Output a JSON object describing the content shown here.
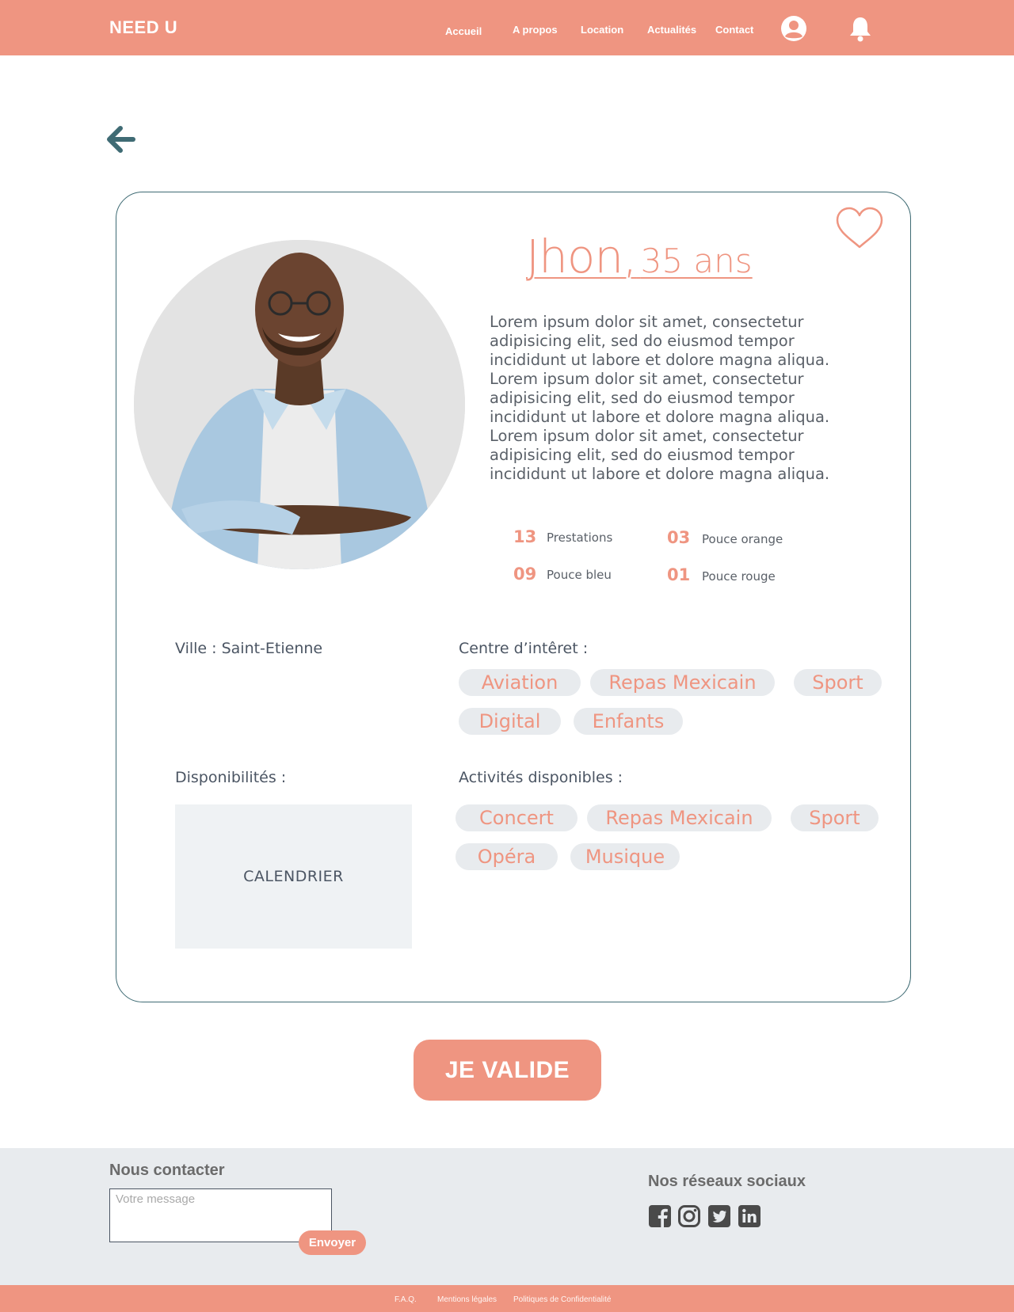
{
  "header": {
    "brand": "NEED U",
    "nav": [
      {
        "label": "Accueil"
      },
      {
        "label": "A propos"
      },
      {
        "label": "Location"
      },
      {
        "label": "Actualités"
      },
      {
        "label": "Contact"
      }
    ],
    "icons": [
      "user-avatar-icon",
      "bell-icon"
    ]
  },
  "profile": {
    "name": "Jhon,",
    "age": "35 ans",
    "bio": "Lorem ipsum dolor sit amet, consectetur adipisicing elit, sed do eiusmod tempor incididunt ut labore et dolore magna aliqua. Lorem ipsum dolor sit amet, consectetur adipisicing elit, sed do eiusmod tempor incididunt ut labore et dolore magna aliqua. Lorem ipsum dolor sit amet, consectetur adipisicing elit, sed do eiusmod tempor incididunt ut labore et dolore magna aliqua.",
    "stats": [
      {
        "value": "13",
        "label": "Prestations"
      },
      {
        "value": "03",
        "label": "Pouce orange"
      },
      {
        "value": "09",
        "label": "Pouce bleu"
      },
      {
        "value": "01",
        "label": "Pouce rouge"
      }
    ],
    "city_label": "Ville : Saint-Etienne",
    "interests_label": "Centre d’intêret :",
    "interests": [
      "Aviation",
      "Repas Mexicain",
      "Sport",
      "Digital",
      "Enfants"
    ],
    "availability_label": "Disponibilités :",
    "calendar_label": "CALENDRIER",
    "activities_label": "Activités disponibles :",
    "activities": [
      "Concert",
      "Repas Mexicain",
      "Sport",
      "Opéra",
      "Musique"
    ]
  },
  "validate_button": "JE VALIDE",
  "footer": {
    "contact_title": "Nous contacter",
    "message_placeholder": "Votre message",
    "send_label": "Envoyer",
    "social_title": "Nos réseaux sociaux",
    "social_icons": [
      "facebook-icon",
      "instagram-icon",
      "twitter-icon",
      "linkedin-icon"
    ],
    "links": [
      "F.A.Q.",
      "Mentions légales",
      "Politiques de Confidentialité"
    ]
  },
  "colors": {
    "accent": "#EF9581",
    "border": "#3f6b74",
    "tag_bg": "#E8EBEE",
    "footer_bg": "#E8EBEE"
  }
}
